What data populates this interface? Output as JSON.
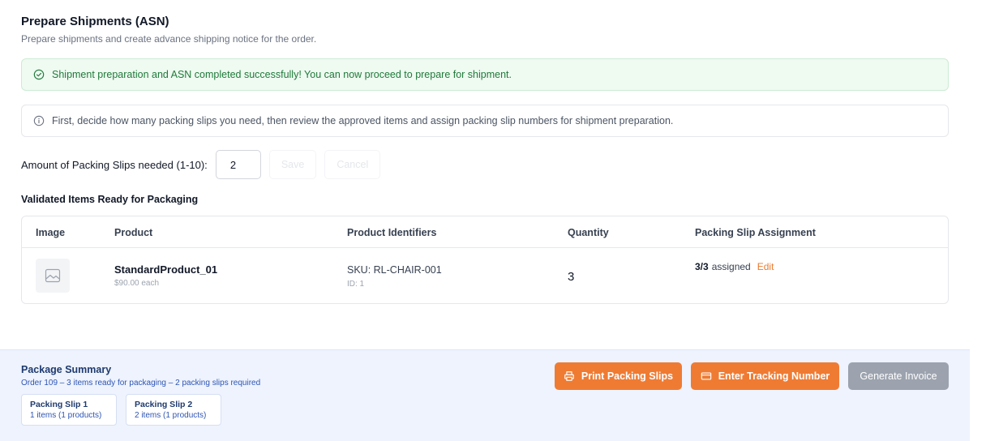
{
  "header": {
    "title": "Prepare Shipments (ASN)",
    "subtitle": "Prepare shipments and create advance shipping notice for the order."
  },
  "alerts": {
    "success": "Shipment preparation and ASN completed successfully! You can now proceed to prepare for shipment.",
    "info": "First, decide how many packing slips you need, then review the approved items and assign packing slip numbers for shipment preparation."
  },
  "slips_form": {
    "label": "Amount of Packing Slips needed (1-10):",
    "value": "2",
    "save_label": "Save",
    "cancel_label": "Cancel"
  },
  "items_section": {
    "heading": "Validated Items Ready for Packaging",
    "columns": [
      "Image",
      "Product",
      "Product Identifiers",
      "Quantity",
      "Packing Slip Assignment"
    ],
    "rows": [
      {
        "image_icon": "image-placeholder-icon",
        "product_name": "StandardProduct_01",
        "price": "$90.00 each",
        "sku": "SKU: RL-CHAIR-001",
        "id": "ID: 1",
        "quantity": "3",
        "assigned_count": "3/3",
        "assigned_text": "assigned",
        "edit_label": "Edit"
      }
    ]
  },
  "summary": {
    "title": "Package Summary",
    "description": "Order 109 – 3 items ready for packaging – 2 packing slips required",
    "slips": [
      {
        "name": "Packing Slip 1",
        "info": "1 items (1 products)"
      },
      {
        "name": "Packing Slip 2",
        "info": "2 items (1 products)"
      }
    ],
    "buttons": {
      "print": "Print Packing Slips",
      "tracking": "Enter Tracking Number",
      "invoice": "Generate Invoice"
    }
  },
  "colors": {
    "accent": "#ef7b33",
    "success_text": "#1f7a3a",
    "success_bg": "#effaf1",
    "summary_bg": "#eef3fd",
    "disabled": "#9ca3af"
  }
}
